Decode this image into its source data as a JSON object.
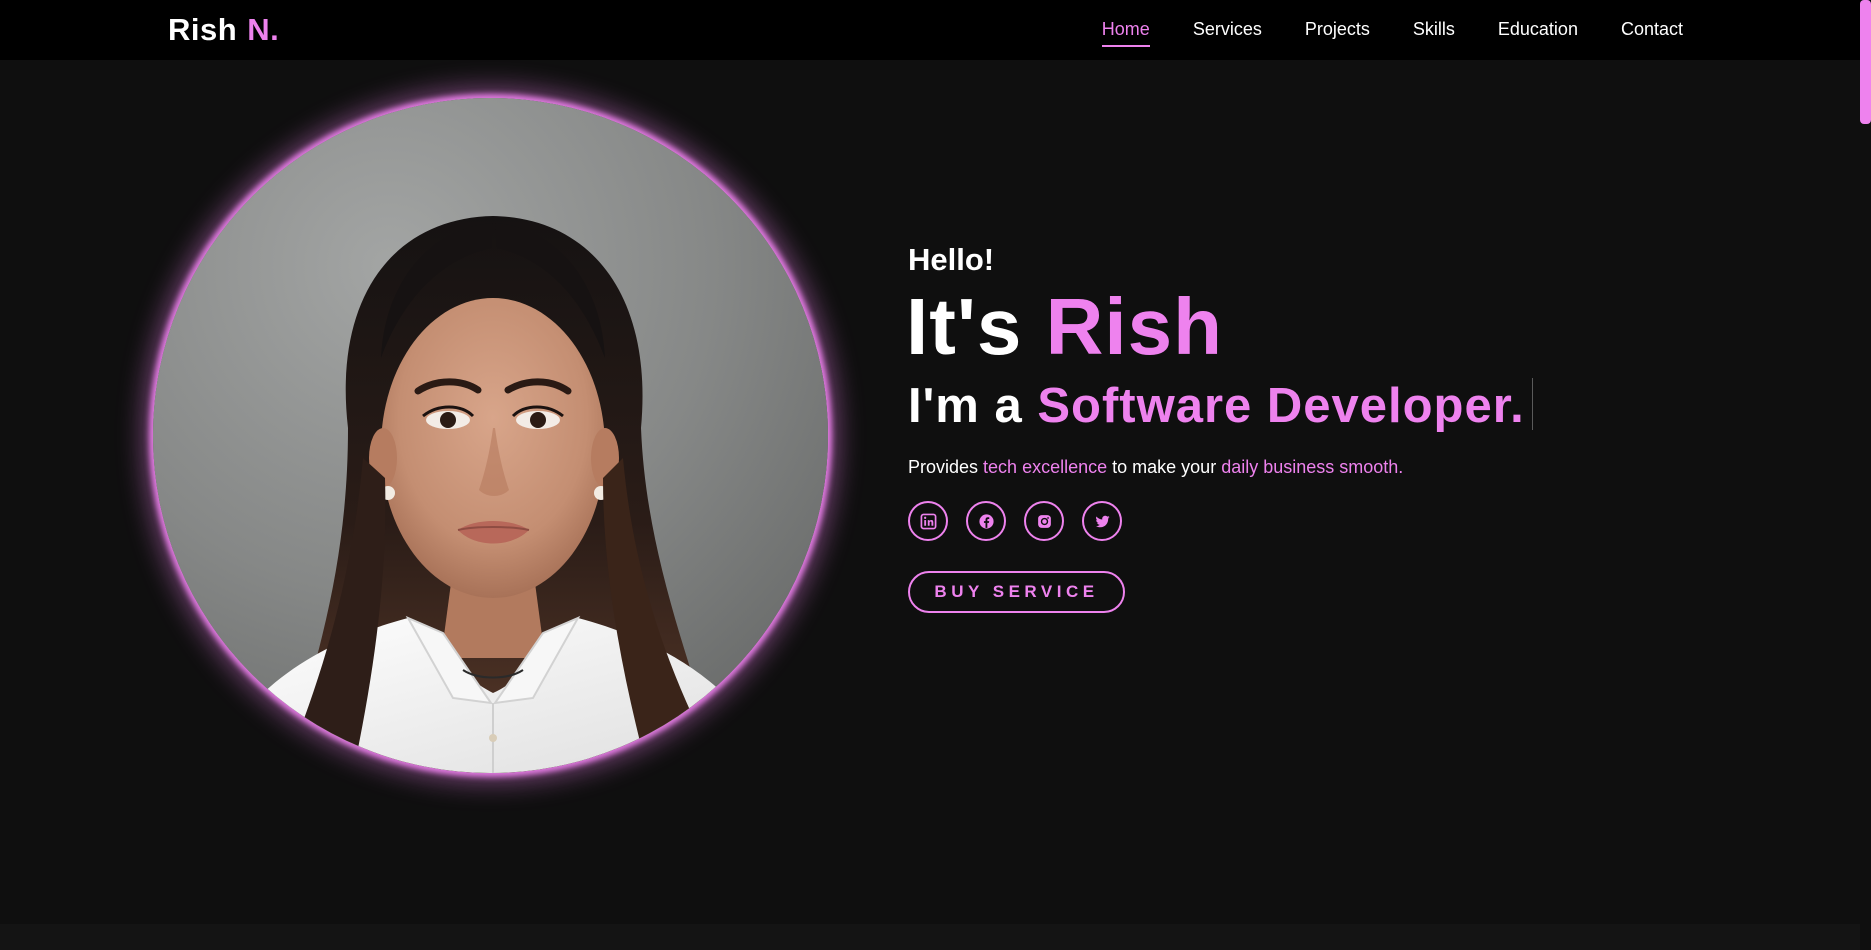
{
  "brand": {
    "name": "Rish",
    "accent": "N.",
    "accent_color": "#ee82ee"
  },
  "nav": {
    "items": [
      {
        "label": "Home",
        "active": true
      },
      {
        "label": "Services",
        "active": false
      },
      {
        "label": "Projects",
        "active": false
      },
      {
        "label": "Skills",
        "active": false
      },
      {
        "label": "Education",
        "active": false
      },
      {
        "label": "Contact",
        "active": false
      }
    ]
  },
  "hero": {
    "greeting": "Hello!",
    "name_prefix": "It's",
    "name": "Rish",
    "role_prefix": "I'm a",
    "role": "Software Developer.",
    "tagline": {
      "part1": "Provides",
      "highlight1": "tech excellence",
      "part2": "to make your",
      "highlight2": "daily business smooth."
    },
    "socials": [
      {
        "icon": "linkedin-icon"
      },
      {
        "icon": "facebook-icon"
      },
      {
        "icon": "instagram-icon"
      },
      {
        "icon": "twitter-icon"
      }
    ],
    "cta_label": "BUY SERVICE"
  },
  "colors": {
    "background": "#0f0f0f",
    "header": "#000000",
    "accent": "#ee82ee",
    "text": "#ffffff"
  }
}
